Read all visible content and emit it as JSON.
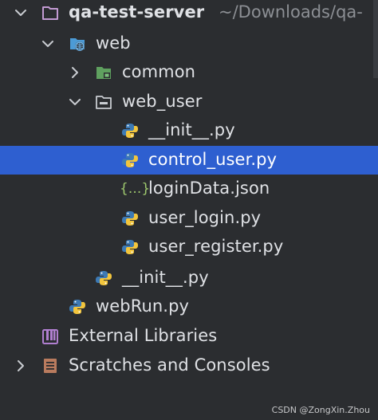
{
  "project": {
    "name": "qa-test-server",
    "path": "~/Downloads/qa-"
  },
  "tree": {
    "web": "web",
    "common": "common",
    "web_user": "web_user",
    "init_inner": "__init__.py",
    "control_user": "control_user.py",
    "login_data": "loginData.json",
    "user_login": "user_login.py",
    "user_register": "user_register.py",
    "init_web": "__init__.py",
    "web_run": "webRun.py",
    "external_libraries": "External Libraries",
    "scratches": "Scratches and Consoles"
  },
  "json_icon_text": "{...}",
  "watermark": "CSDN @ZongXin.Zhou",
  "colors": {
    "background": "#2b2d30",
    "selection": "#2e5fd0",
    "text": "#dfe1e5",
    "path_text": "#8c8f94",
    "python_blue": "#3d7ab5",
    "python_yellow": "#f2c53d",
    "folder_blue": "#4c9bd6",
    "json_green": "#9ec86e"
  },
  "icons": {
    "project_folder": "folder-icon",
    "web_folder": "web-module-folder-icon",
    "common_folder": "package-folder-icon",
    "web_user_folder": "folder-icon",
    "python_file": "python-file-icon",
    "json_file": "json-file-icon",
    "external_libraries": "library-icon",
    "scratches": "scratches-icon"
  }
}
